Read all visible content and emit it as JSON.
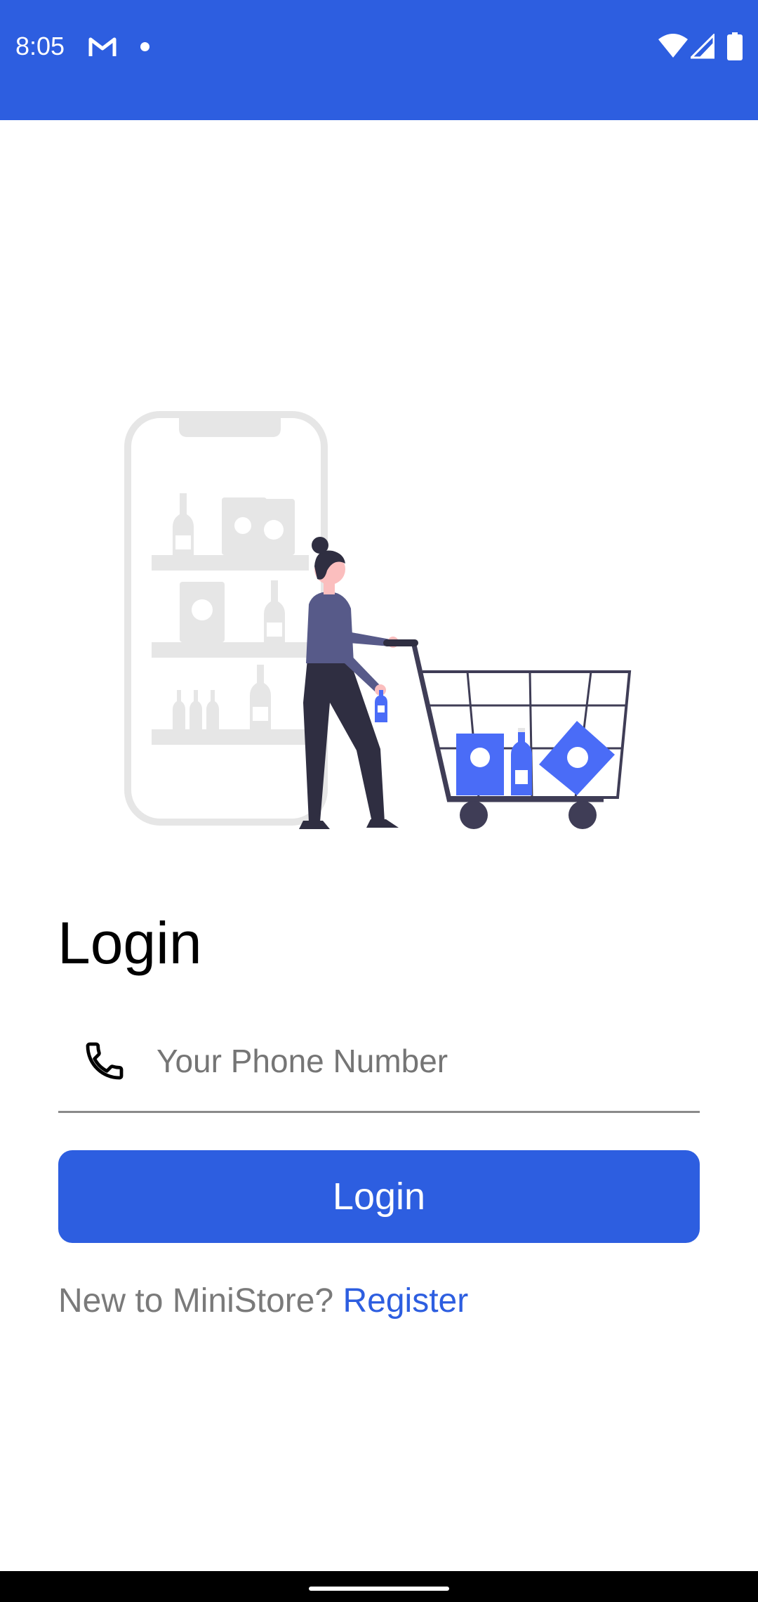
{
  "status_bar": {
    "time": "8:05",
    "background_color": "#2d5ee0",
    "icons": [
      "gmail-icon",
      "notification-dot-icon",
      "wifi-icon",
      "signal-icon",
      "battery-icon"
    ]
  },
  "illustration": {
    "icon": "shopping-cart-illustration",
    "accent_color": "#4a6cf7"
  },
  "login": {
    "title": "Login",
    "phone_placeholder": "Your Phone Number",
    "phone_value": "",
    "button_label": "Login",
    "register_prompt": "New to MiniStore?",
    "register_link": "Register"
  },
  "colors": {
    "primary": "#2d5ee0",
    "muted_text": "#7a7a7a"
  }
}
